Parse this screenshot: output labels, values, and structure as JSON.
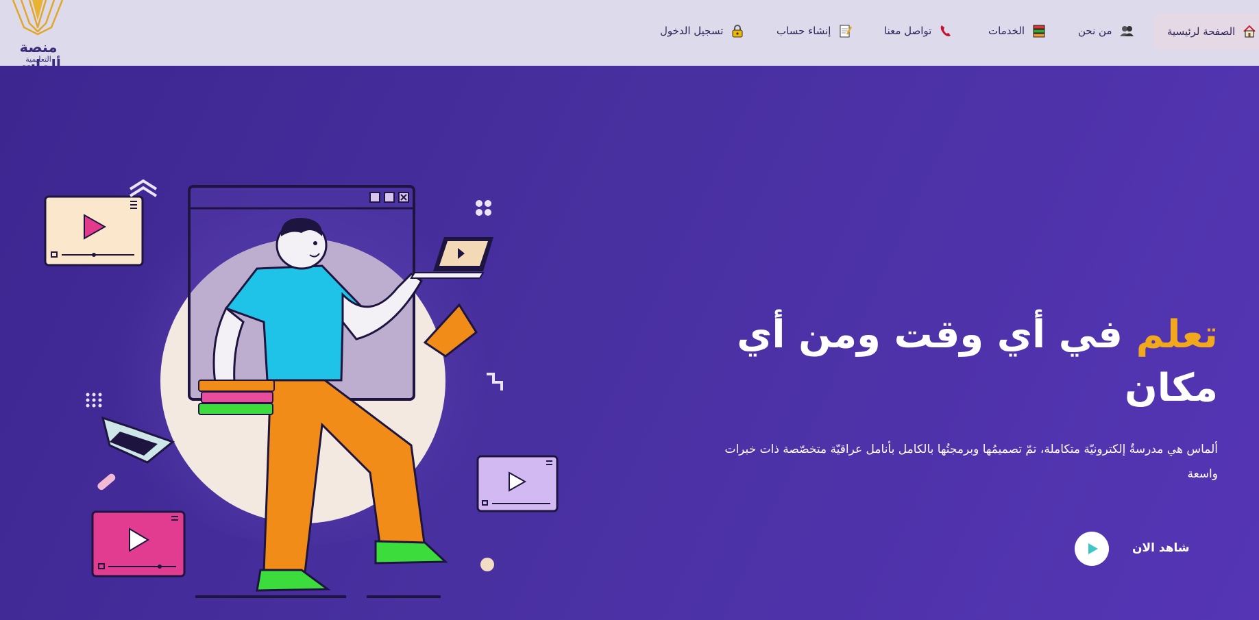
{
  "logo": {
    "title": "منصة ألماس",
    "subtitle": "التعليمية"
  },
  "nav": {
    "home": "الصفحة لرئيسية",
    "about": "من نحن",
    "services": "الخدمات",
    "contact": "تواصل معنا",
    "register": "إنشاء حساب",
    "login": "تسجيل الدخول"
  },
  "icons": [
    "home-icon",
    "people-icon",
    "books-icon",
    "phone-icon",
    "memo-icon",
    "lock-icon",
    "play-icon"
  ],
  "hero": {
    "title_accent": "تعلم",
    "title_rest": " في أي وقت ومن أي مكان",
    "description": "ألماس هي مدرسةٌ إلكترونيّة متكاملة، تمّ تصميمُها وبرمجتُها بالكامل بأنامل عراقيّة متخصّصة ذات خبرات واسعة",
    "cta_label": "شاهد الان"
  },
  "colors": {
    "nav_bg": "#dcdaeb",
    "hero_bg": "#4a2fa0",
    "accent": "#f2a81d",
    "text_dark": "#2b2355"
  }
}
